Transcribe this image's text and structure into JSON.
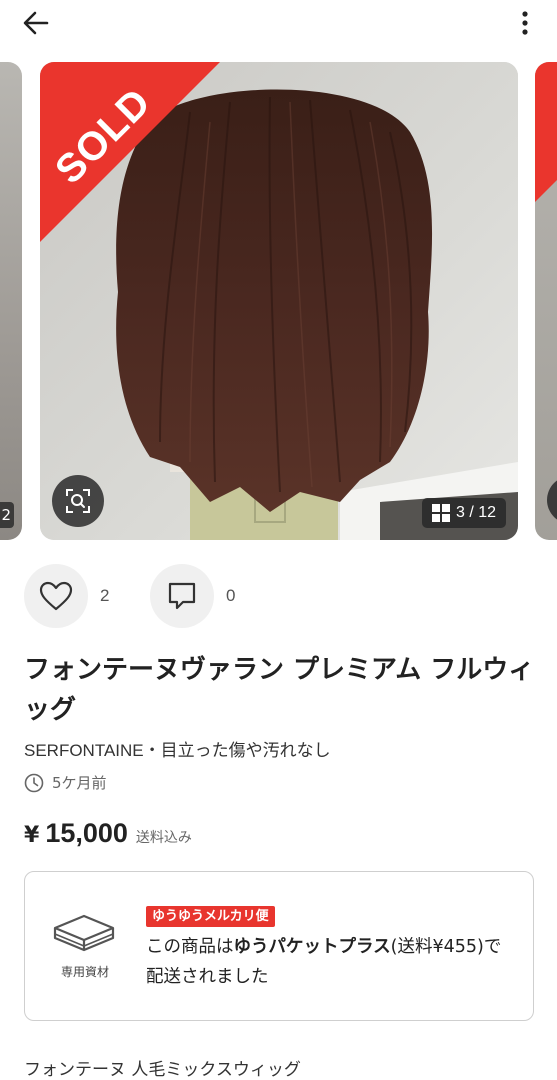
{
  "header": {
    "back_icon": "arrow-left-icon",
    "menu_icon": "more-vertical-icon"
  },
  "gallery": {
    "sold_label": "SOLD",
    "counter": "3 / 12",
    "prev_counter_fragment": "2",
    "zoom_icon": "image-search-icon",
    "grid_icon": "grid-icon",
    "colors": {
      "sold_red": "#ea352d"
    }
  },
  "actions": {
    "like_count": "2",
    "comment_count": "0",
    "like_icon": "heart-icon",
    "comment_icon": "comment-icon"
  },
  "item": {
    "title": "フォンテーヌヴァラン プレミアム フルウィッグ",
    "brand_condition": "SERFONTAINE・目立った傷や汚れなし",
    "posted": "5ケ月前",
    "price_symbol": "¥",
    "price": "15,000",
    "price_note": "送料込み"
  },
  "shipping": {
    "box_label": "専用資材",
    "badge": "ゆうゆうメルカリ便",
    "text_prefix": "この商品は",
    "text_bold": "ゆうパケットプラス",
    "text_suffix": "(送料¥455)で配送されました"
  },
  "description": {
    "first_line": "フォンテーヌ 人毛ミックスウィッグ"
  }
}
